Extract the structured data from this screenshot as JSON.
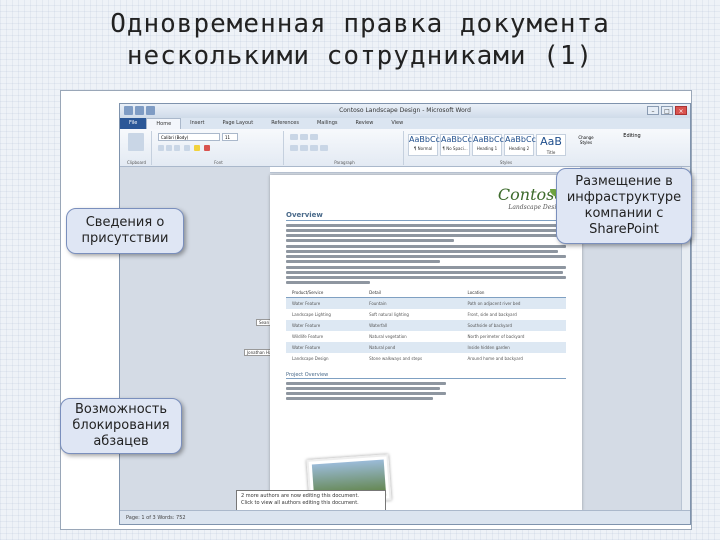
{
  "slide": {
    "title_line1": "Одновременная правка документа",
    "title_line2": "несколькими сотрудниками (1)"
  },
  "word": {
    "window_title": "Contoso Landscape Design - Microsoft Word",
    "tabs": [
      "File",
      "Home",
      "Insert",
      "Page Layout",
      "References",
      "Mailings",
      "Review",
      "View"
    ],
    "active_tab": "Home",
    "ribbon_groups": [
      "Clipboard",
      "Font",
      "Paragraph",
      "Styles"
    ],
    "font_name": "Calibri (Body)",
    "font_size": "11",
    "styles": [
      {
        "sample": "AaBbCcDc",
        "name": "¶ Normal"
      },
      {
        "sample": "AaBbCcDc",
        "name": "¶ No Spaci..."
      },
      {
        "sample": "AaBbCc",
        "name": "Heading 1"
      },
      {
        "sample": "AaBbCc",
        "name": "Heading 2"
      },
      {
        "sample": "AaB",
        "name": "Title"
      }
    ],
    "change_styles": "Change Styles",
    "editing": "Editing",
    "logo_main": "Contoso",
    "logo_sub": "Landscape Design",
    "overview_heading": "Overview",
    "table_headers": [
      "Product/Service",
      "Detail",
      "Location"
    ],
    "table_rows": [
      [
        "Water Feature",
        "Fountain",
        "Path on adjacent river bed"
      ],
      [
        "Landscape Lighting",
        "Soft natural lighting",
        "Front, side and backyard"
      ],
      [
        "Water Feature",
        "Waterfall",
        "Southside of backyard"
      ],
      [
        "Wildlife Feature",
        "Natural vegetation",
        "North perimeter of backyard"
      ],
      [
        "Water Feature",
        "Natural pond",
        "Inside hidden garden"
      ],
      [
        "Landscape Design",
        "Stone walkways and steps",
        "Around home and backyard"
      ]
    ],
    "project_heading": "Project Overview",
    "presence_1": "Sean Alexander",
    "presence_2": "Jonathan Haas",
    "popup_line1": "2 more authors are now editing this document.",
    "popup_line2": "Click to view all authors editing this document.",
    "status": "Page: 1 of 3   Words: 752"
  },
  "callouts": {
    "presence": "Сведения о присутствии",
    "sharepoint": "Размещение в инфраструктуре компании с SharePoint",
    "locking": "Возможность блокирования абзацев"
  },
  "colors": {
    "file_tab": "#2b5797",
    "callout_fill": "#dfe6f4",
    "logo_green": "#3d6b2c"
  }
}
